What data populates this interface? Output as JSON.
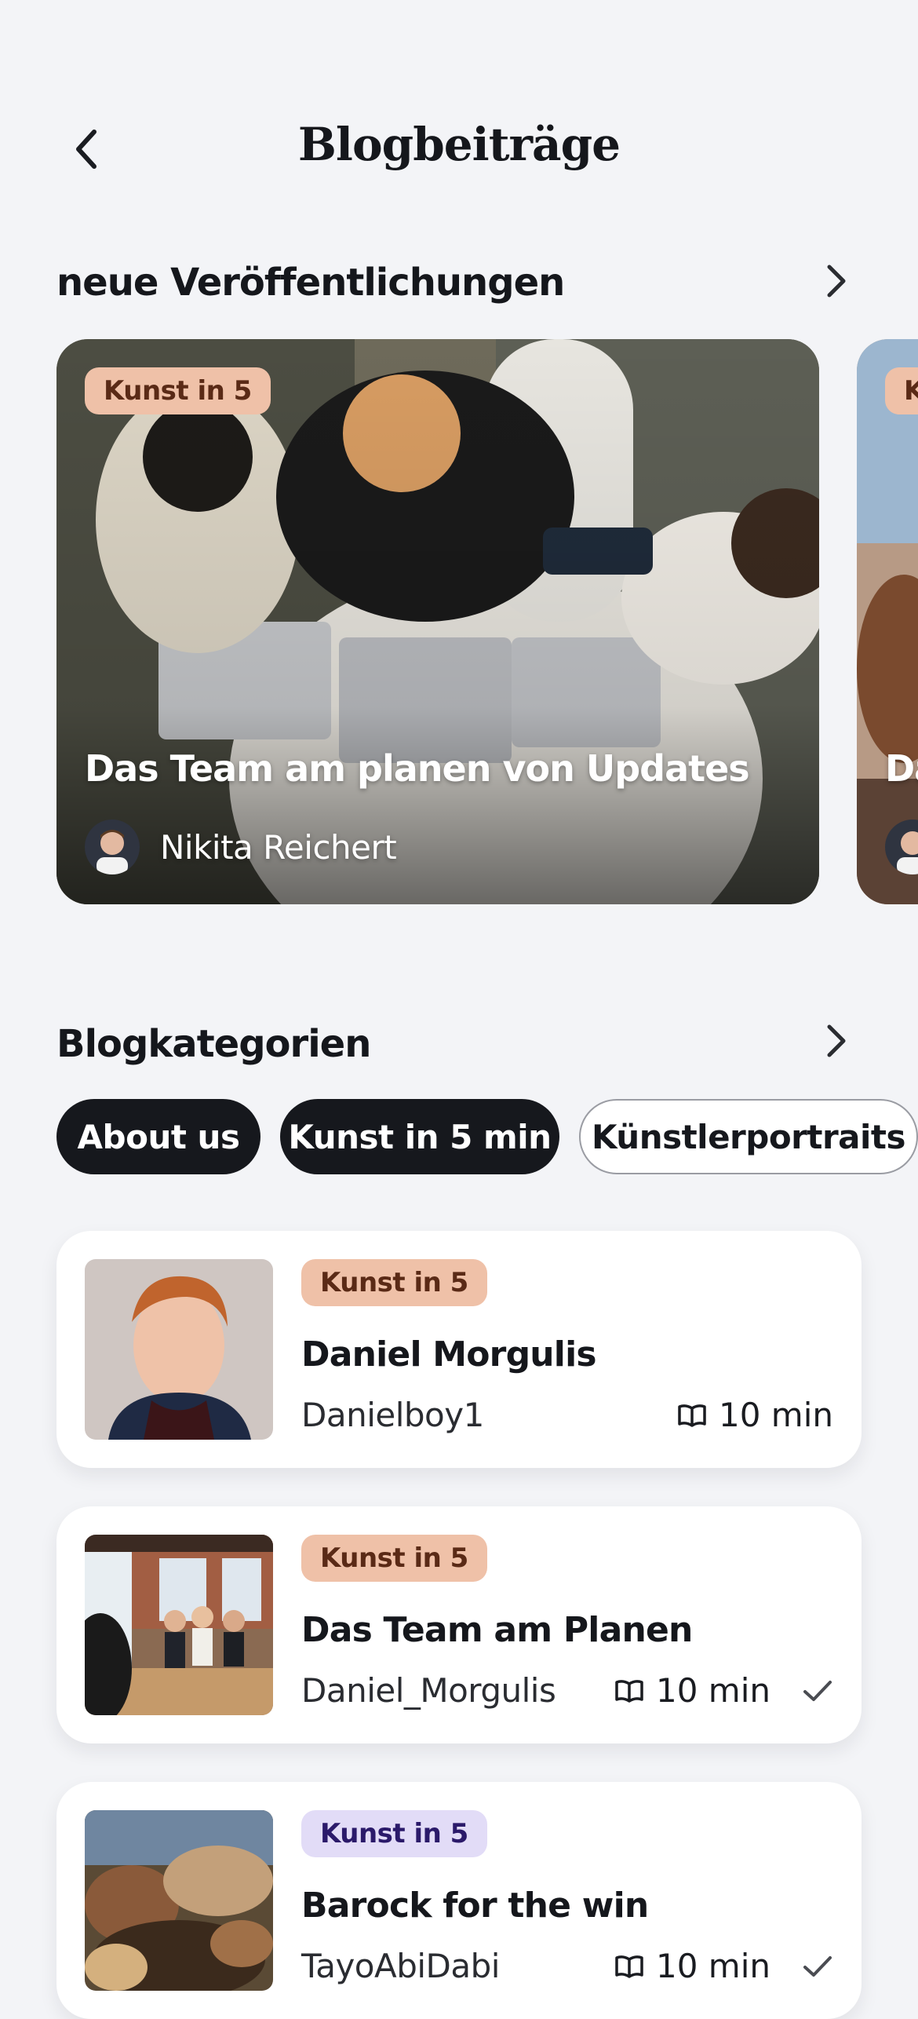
{
  "header": {
    "title": "Blogbeiträge",
    "back_icon": "chevron-left-icon"
  },
  "featured": {
    "section_title": "neue Veröffentlichungen",
    "cards": [
      {
        "badge": "Kunst in 5",
        "title": "Das Team am planen von Updates",
        "author": "Nikita Reichert"
      },
      {
        "badge": "K",
        "title": "Da",
        "author": ""
      }
    ]
  },
  "categories": {
    "section_title": "Blogkategorien",
    "chips": [
      {
        "label": "About us",
        "selected": true
      },
      {
        "label": "Kunst in 5 min",
        "selected": true
      },
      {
        "label": "Künstlerportraits",
        "selected": false
      }
    ]
  },
  "posts": [
    {
      "badge": "Kunst in 5",
      "badge_color": "#efc1a8",
      "title": "Daniel Morgulis",
      "author": "Danielboy1",
      "read_time": "10 min",
      "read": false
    },
    {
      "badge": "Kunst in 5",
      "badge_color": "#efc1a8",
      "title": "Das Team am Planen",
      "author": "Daniel_Morgulis",
      "read_time": "10 min",
      "read": true
    },
    {
      "badge": "Kunst in 5",
      "badge_color": "#e2dcf7",
      "title": "Barock for the win",
      "author": "TayoAbiDabi",
      "read_time": "10 min",
      "read": true
    }
  ],
  "colors": {
    "background": "#f3f4f7",
    "accent_dark": "#16181d",
    "badge_peach": "#efc1a8",
    "badge_lilac": "#e2dcf7"
  }
}
